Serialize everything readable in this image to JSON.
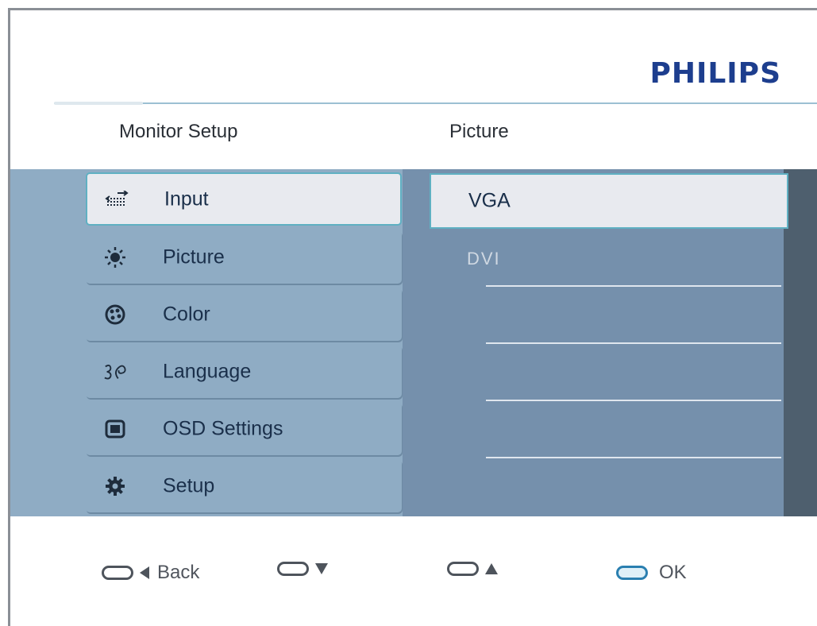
{
  "brand": "PHILIPS",
  "columns": {
    "left_title": "Monitor Setup",
    "right_title": "Picture"
  },
  "menu": [
    {
      "label": "Input",
      "icon": "input-arrows-icon",
      "selected": true
    },
    {
      "label": "Picture",
      "icon": "sun-icon",
      "selected": false
    },
    {
      "label": "Color",
      "icon": "palette-icon",
      "selected": false
    },
    {
      "label": "Language",
      "icon": "language-icon",
      "selected": false
    },
    {
      "label": "OSD Settings",
      "icon": "screen-icon",
      "selected": false
    },
    {
      "label": "Setup",
      "icon": "gear-icon",
      "selected": false
    }
  ],
  "options": [
    {
      "label": "VGA",
      "selected": true
    },
    {
      "label": "DVI",
      "selected": false
    }
  ],
  "hints": {
    "back": "Back",
    "ok": "OK"
  },
  "colors": {
    "brand": "#1d3e8e",
    "left_panel": "#8facc4",
    "right_panel": "#7590ac",
    "selection_border": "#5fb0c2",
    "selection_fill": "#e8eaef"
  }
}
